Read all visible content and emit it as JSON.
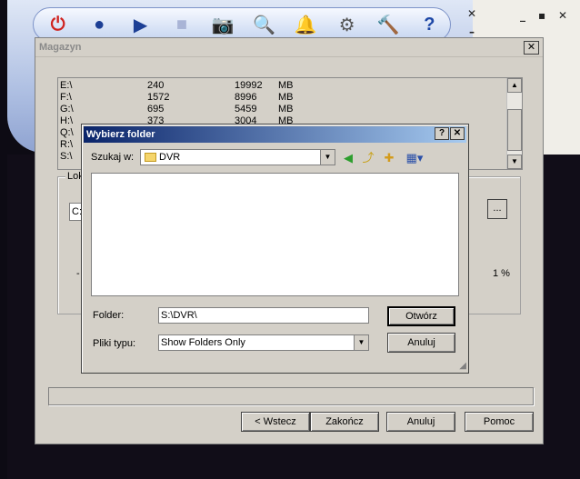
{
  "app": {
    "toolbar_icons": [
      "power-icon",
      "record-icon",
      "play-icon",
      "stop-icon",
      "camera-icon",
      "search-icon",
      "bell-icon",
      "settings-icon",
      "hammer-icon",
      "help-icon"
    ],
    "toolbar_glyphs": [
      "⏻",
      "●",
      "▶",
      "■",
      "📷",
      "🔍",
      "🔔",
      "⚙",
      "🔨",
      "?"
    ],
    "close_glyph": "✕",
    "min_glyph": "–",
    "side_min": "_",
    "side_max": "▪",
    "side_close": "✕"
  },
  "magazyn": {
    "title": "Magazyn",
    "close": "✕",
    "drives": [
      {
        "drive": "E:\\",
        "a": "240",
        "b": "19992",
        "unit": "MB"
      },
      {
        "drive": "F:\\",
        "a": "1572",
        "b": "8996",
        "unit": "MB"
      },
      {
        "drive": "G:\\",
        "a": "695",
        "b": "5459",
        "unit": "MB"
      },
      {
        "drive": "H:\\",
        "a": "373",
        "b": "3004",
        "unit": "MB"
      },
      {
        "drive": "Q:\\",
        "a": "",
        "b": "",
        "unit": ""
      },
      {
        "drive": "R:\\",
        "a": "",
        "b": "",
        "unit": ""
      },
      {
        "drive": "S:\\",
        "a": "",
        "b": "",
        "unit": ""
      }
    ],
    "group_label": "Lok",
    "path_value": "C:",
    "browse_label": "...",
    "dash": "-",
    "percent": "1 %",
    "buttons": {
      "back": "< Wstecz",
      "finish": "Zakończ",
      "cancel": "Anuluj",
      "help": "Pomoc"
    }
  },
  "folder_dialog": {
    "title": "Wybierz folder",
    "help_btn": "?",
    "close_btn": "✕",
    "lookin_label": "Szukaj w:",
    "lookin_value": "DVR",
    "folder_label": "Folder:",
    "folder_value": "S:\\DVR\\",
    "filetype_label": "Pliki typu:",
    "filetype_value": "Show Folders Only",
    "open_btn": "Otwórz",
    "cancel_btn": "Anuluj",
    "tool_glyphs": {
      "back": "◀",
      "up": "⤴",
      "newfolder": "✚",
      "view": "▦▾"
    }
  }
}
